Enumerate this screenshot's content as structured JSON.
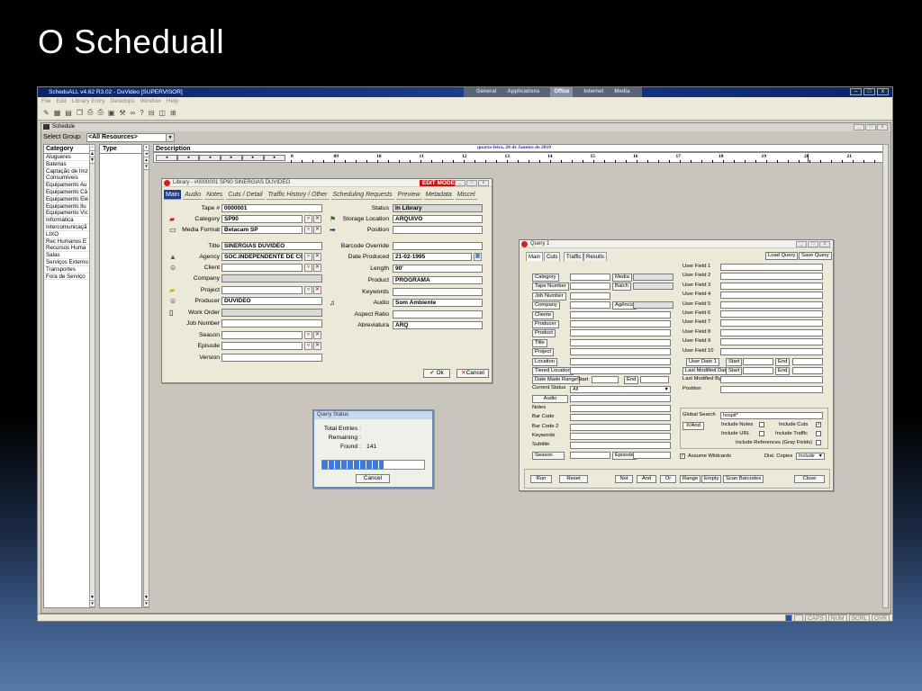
{
  "slide_title": "O Scheduall",
  "app": {
    "title": "ScheduALL v4.62 R3.02 - DuVideo [SUPERVISOR]",
    "top_tabs": [
      "General",
      "Applications",
      "Office",
      "Internet",
      "Media"
    ],
    "active_tab": "Office",
    "menus": [
      "File",
      "Edit",
      "Library Entry",
      "Desktops",
      "Window",
      "Help"
    ]
  },
  "schedule": {
    "title": "Schedule",
    "select_group_label": "Select Group:",
    "select_group_value": "<All Resources>",
    "category_header": "Category",
    "type_header": "Type",
    "description_header": "Description",
    "categories": [
      "Alugueres",
      "Baterias",
      "Captação de Imz",
      "Consumíveis",
      "Equipamento Au",
      "Equipamento Câ",
      "Equipamento Ele",
      "Equipamento Ilu",
      "Equipamento Vic",
      "Informática",
      "Intercomunicaçã",
      "LIXO",
      "Rec Humanos E",
      "Recursos Huma",
      "Salas",
      "Serviços Externo",
      "Transportes",
      "Fora de Serviço"
    ],
    "date": "quarta-feira, 20 de Janeiro de 2010",
    "hours": [
      "8",
      "09",
      "10",
      "11",
      "12",
      "13",
      "14",
      "15",
      "16",
      "17",
      "18",
      "19",
      "20",
      "21"
    ]
  },
  "status_cells": [
    "CAPS",
    "NUM",
    "SCRL",
    "OVR"
  ],
  "library": {
    "title": "Library - #0000001 SP90 SINERGIAS DUVIDEO",
    "edit_mode": "EDIT MODE",
    "tabs": [
      "Main",
      "Audio",
      "Notes",
      "Cuts / Detail",
      "Traffic History / Other",
      "Scheduling Requests",
      "Preview",
      "Metadata",
      "Miscel"
    ],
    "fields": {
      "tape_label": "Tape #",
      "tape": "0000001",
      "category_label": "Category",
      "category": "SP90",
      "media_label": "Media Format",
      "media": "Betacam SP",
      "title_label": "Title",
      "title": "SINERGIAS DUVIDEO",
      "agency_label": "Agency",
      "agency": "SOC.INDEPENDENTE DE COMUN",
      "client_label": "Client",
      "company_label": "Company",
      "project_label": "Project",
      "producer_label": "Producer",
      "producer": "DUVIDEO",
      "workorder_label": "Work Order",
      "jobnumber_label": "Job Number",
      "season_label": "Season",
      "episode_label": "Episode",
      "version_label": "Version",
      "status_label": "Status",
      "status": "In Library",
      "storage_label": "Storage Location",
      "storage": "ARQUIVO",
      "position_label": "Position",
      "barcode_label": "Barcode Override",
      "dateprod_label": "Date Produced",
      "dateprod": "21-02-1995",
      "length_label": "Length",
      "length": "90'",
      "product_label": "Product",
      "product": "PROGRAMA",
      "keywords_label": "Keywords",
      "audio_label": "Audio",
      "audio": "Som Ambiente",
      "aspect_label": "Aspect Ratio",
      "abrev_label": "Abreviatura",
      "abrev": "ARQ"
    },
    "ok": "Ok",
    "cancel": "Cancel"
  },
  "query": {
    "title": "Query 1",
    "tabs": [
      "Main",
      "Cuts",
      "Traffic",
      "Results"
    ],
    "load": "Load Query",
    "save": "Save Query",
    "left_btns": [
      "Category",
      "Tape Number",
      "Job Number",
      "Company",
      "Cliente",
      "Producer",
      "Product",
      "Title",
      "Project",
      "Location",
      "Tiered Location"
    ],
    "media": "Media",
    "batch": "Batch",
    "agencia": "Agência",
    "date_made": "Date Made Range",
    "start": "Start",
    "end": "End",
    "current_status": "Current Status",
    "current_status_value": "All",
    "audio": "Audio",
    "lower_labels": [
      "Notes",
      "Bar Code",
      "Bar Code 2",
      "Keywords",
      "Subtitle"
    ],
    "season": "Season",
    "episode": "Episode",
    "user_fields": [
      "User Field 1",
      "User Field 2",
      "User Field 3",
      "User Field 4",
      "User Field 5",
      "User Field 6",
      "User Field 7",
      "User Field 8",
      "User Field 9",
      "User Field 10"
    ],
    "user_date": "User Date 1",
    "last_mod_date": "Last Modified Date",
    "last_mod_by": "Last Modified By",
    "position": "Position",
    "global_search": "Global Search",
    "global_value": "hospit*",
    "andor": "X/And",
    "inc_notes": "Include Notes",
    "inc_cuts": "Include Cuts",
    "inc_url": "Include URL",
    "inc_traffic": "Include Traffic",
    "inc_refs": "Include References (Gray Fields)",
    "assume": "Assume Wildcards",
    "dist": "Dist. Copies",
    "dist_value": "Include",
    "bottom": [
      "Run",
      "Reset",
      "Not",
      "And",
      "Or",
      "Range",
      "Empty",
      "Scan Barcodes",
      "Close"
    ]
  },
  "qstatus": {
    "title": "Query Status",
    "total": "Total Entries :",
    "remaining": "Remaining :",
    "found": "Found :",
    "found_value": "141",
    "cancel": "Cancel",
    "progress": 0.6
  }
}
